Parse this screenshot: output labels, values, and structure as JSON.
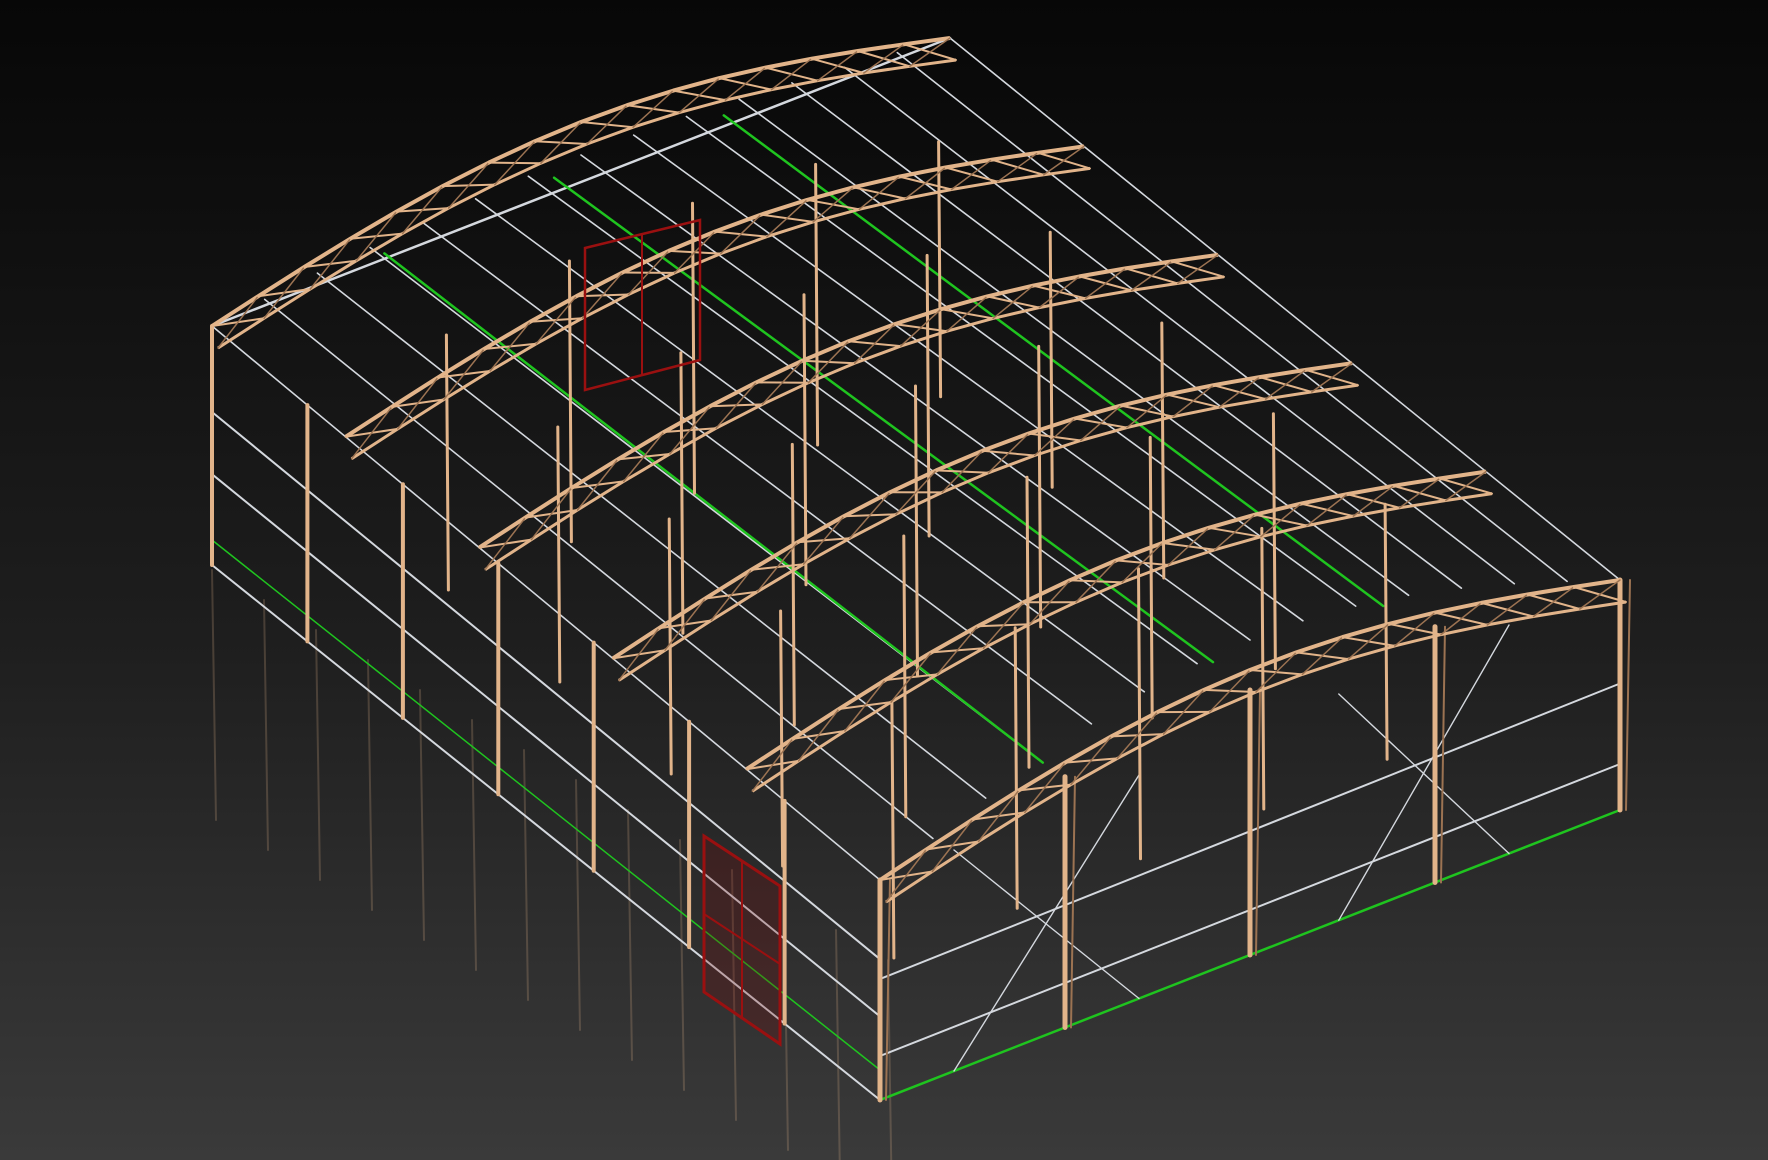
{
  "scene": {
    "description_visible_text": "",
    "colors": {
      "background_top": "#070707",
      "background_bottom": "#3a3a3a",
      "steel_frame": "#e2b48a",
      "steel_frame_dark": "#9c7352",
      "purlin_white": "#d4d8de",
      "bracing_green": "#1fc41f",
      "door_red": "#9a1010"
    },
    "structure": {
      "type": "steel-frame-warehouse",
      "trusses": 6,
      "left_wall_columns": 8,
      "front_gable_columns": 5,
      "doors": 2
    }
  }
}
